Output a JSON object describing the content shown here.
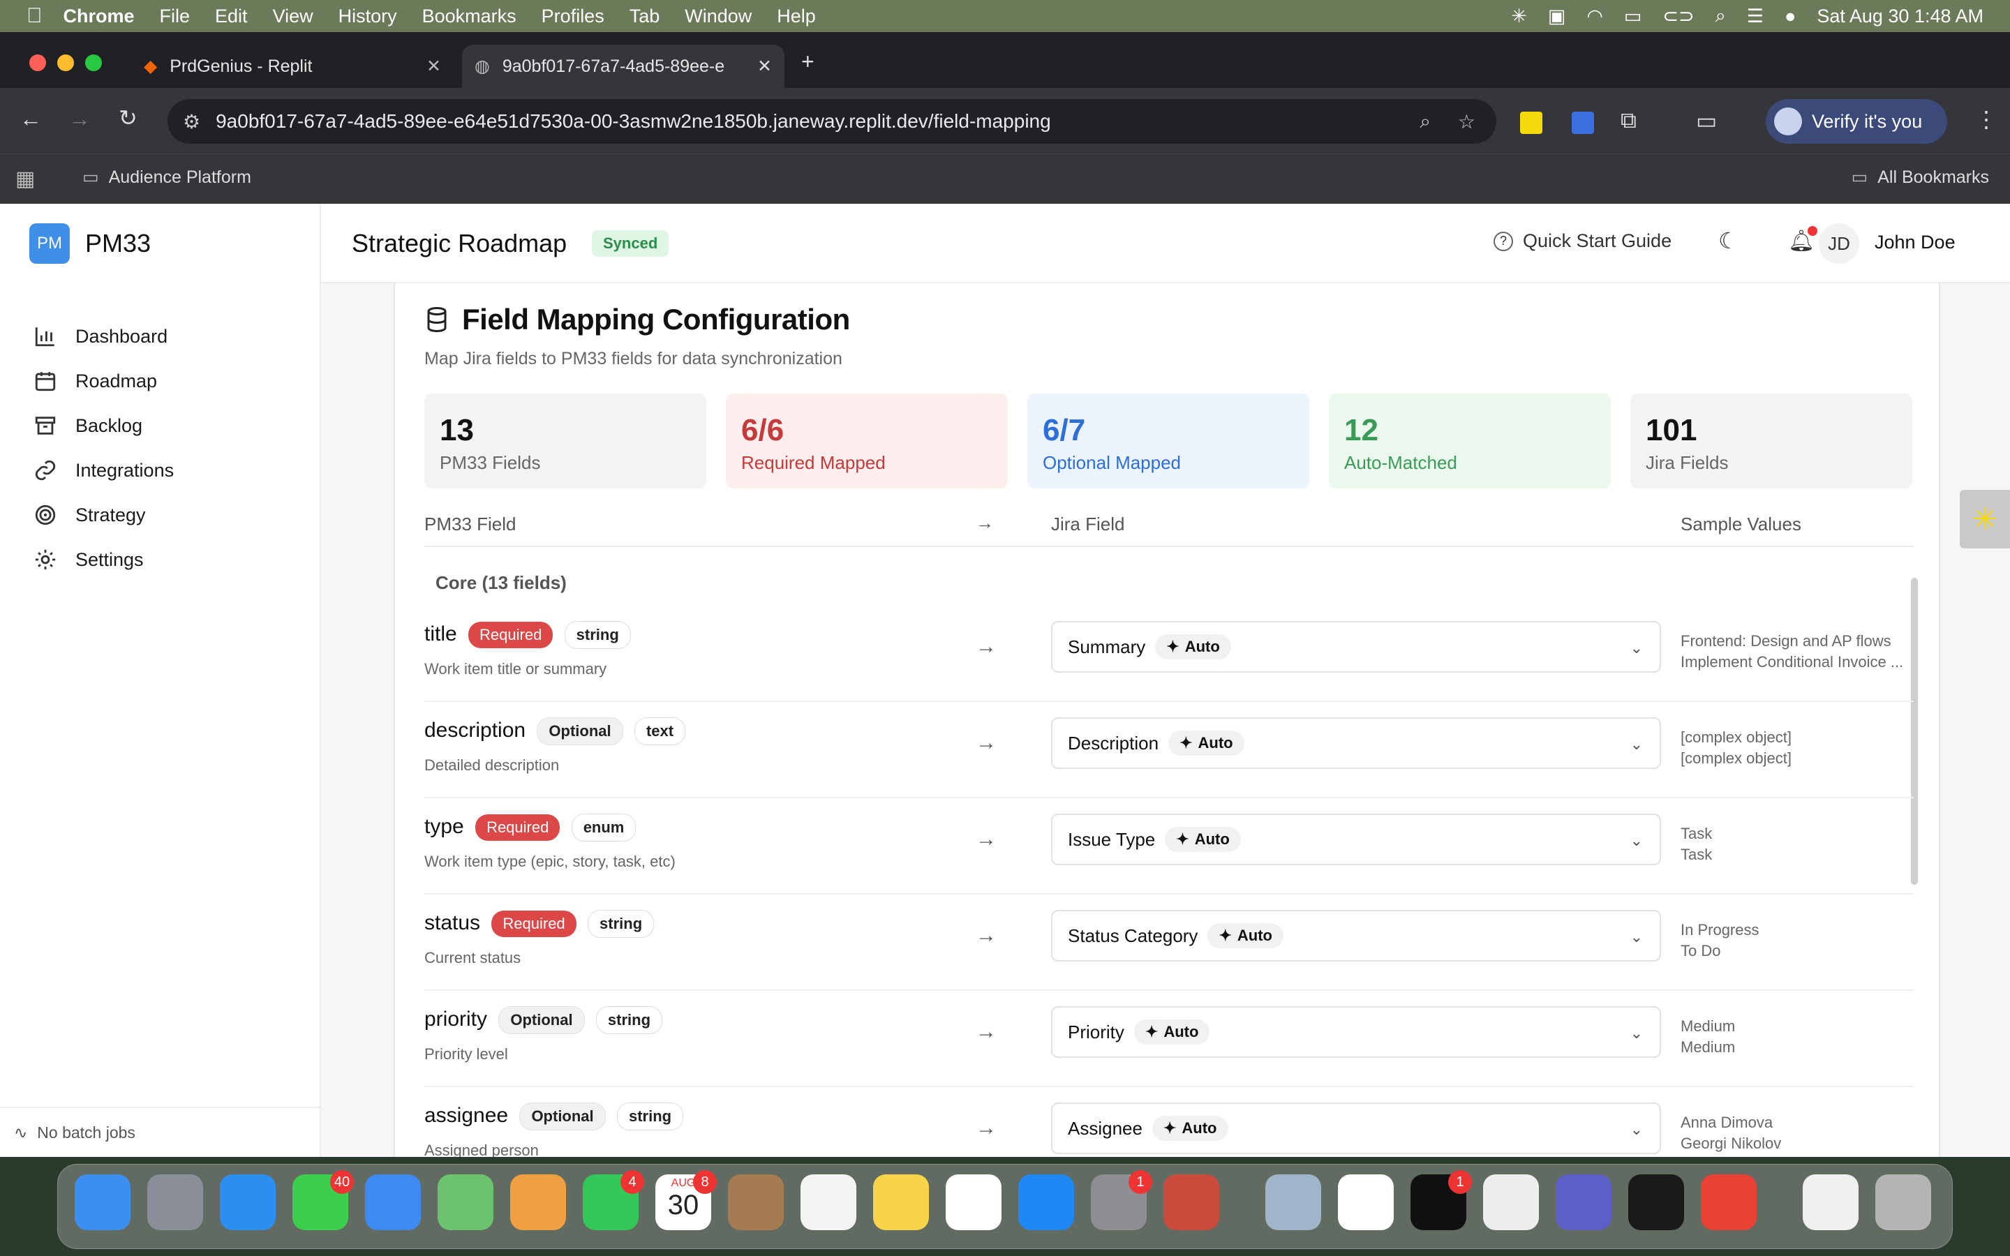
{
  "menubar": {
    "items": [
      "Chrome",
      "File",
      "Edit",
      "View",
      "History",
      "Bookmarks",
      "Profiles",
      "Tab",
      "Window",
      "Help"
    ],
    "datetime": "Sat Aug 30  1:48 AM"
  },
  "browser": {
    "tabs": [
      {
        "title": "PrdGenius - Replit"
      },
      {
        "title": "9a0bf017-67a7-4ad5-89ee-e"
      }
    ],
    "url": "9a0bf017-67a7-4ad5-89ee-e64e51d7530a-00-3asmw2ne1850b.janeway.replit.dev/field-mapping",
    "verify_label": "Verify it's you",
    "bookmark_folder": "Audience Platform",
    "all_bookmarks": "All Bookmarks"
  },
  "app": {
    "logo_badge": "PM",
    "logo_text": "PM33",
    "nav": [
      {
        "label": "Dashboard"
      },
      {
        "label": "Roadmap"
      },
      {
        "label": "Backlog"
      },
      {
        "label": "Integrations"
      },
      {
        "label": "Strategy"
      },
      {
        "label": "Settings"
      }
    ],
    "batch_status": "No batch jobs",
    "header": {
      "title": "Strategic Roadmap",
      "sync_badge": "Synced",
      "quick_start": "Quick Start Guide",
      "avatar_initials": "JD",
      "user_name": "John Doe"
    }
  },
  "page": {
    "title": "Field Mapping Configuration",
    "subtitle": "Map Jira fields to PM33 fields for data synchronization",
    "stats": [
      {
        "value": "13",
        "label": "PM33 Fields"
      },
      {
        "value": "6/6",
        "label": "Required Mapped"
      },
      {
        "value": "6/7",
        "label": "Optional Mapped"
      },
      {
        "value": "12",
        "label": "Auto-Matched"
      },
      {
        "value": "101",
        "label": "Jira Fields"
      }
    ],
    "columns": {
      "pm33": "PM33 Field",
      "arrow": "→",
      "jira": "Jira Field",
      "samples": "Sample Values"
    },
    "group_label": "Core (13 fields)",
    "auto_label": "Auto",
    "rows": [
      {
        "name": "title",
        "req": "Required",
        "type": "string",
        "desc": "Work item title or summary",
        "jira": "Summary",
        "s1": "Frontend: Design and AP flows",
        "s2": "Implement Conditional Invoice ..."
      },
      {
        "name": "description",
        "req": "Optional",
        "type": "text",
        "desc": "Detailed description",
        "jira": "Description",
        "s1": "[complex object]",
        "s2": "[complex object]"
      },
      {
        "name": "type",
        "req": "Required",
        "type": "enum",
        "desc": "Work item type (epic, story, task, etc)",
        "jira": "Issue Type",
        "s1": "Task",
        "s2": "Task"
      },
      {
        "name": "status",
        "req": "Required",
        "type": "string",
        "desc": "Current status",
        "jira": "Status Category",
        "s1": "In Progress",
        "s2": "To Do"
      },
      {
        "name": "priority",
        "req": "Optional",
        "type": "string",
        "desc": "Priority level",
        "jira": "Priority",
        "s1": "Medium",
        "s2": "Medium"
      },
      {
        "name": "assignee",
        "req": "Optional",
        "type": "string",
        "desc": "Assigned person",
        "jira": "Assignee",
        "s1": "Anna Dimova",
        "s2": "Georgi Nikolov"
      }
    ]
  },
  "dock": {
    "badges": {
      "messages": "40",
      "facetime": "4",
      "calendar": "8",
      "settings": "1",
      "terminal": "1"
    },
    "calendar_month": "AUG",
    "calendar_day": "30"
  }
}
